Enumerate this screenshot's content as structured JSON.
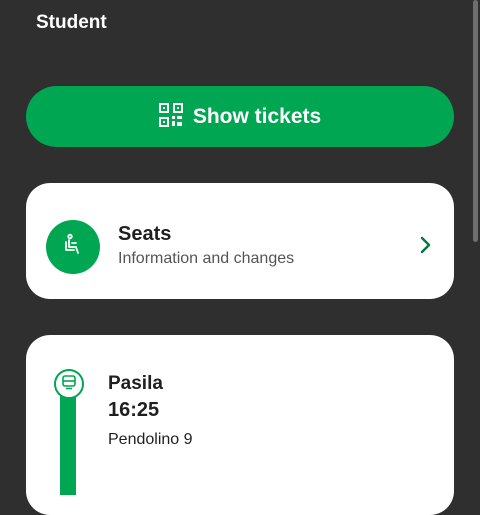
{
  "header": {
    "title": "Student"
  },
  "tickets_button": {
    "label": "Show tickets",
    "icon": "qr-code-icon"
  },
  "seats_card": {
    "title": "Seats",
    "subtitle": "Information and changes",
    "icon": "seat-icon"
  },
  "journey": {
    "stop": "Pasila",
    "time": "16:25",
    "train": "Pendolino 9",
    "icon": "train-icon"
  },
  "colors": {
    "background": "#2f2f2f",
    "accent": "#00a651",
    "card": "#ffffff"
  }
}
